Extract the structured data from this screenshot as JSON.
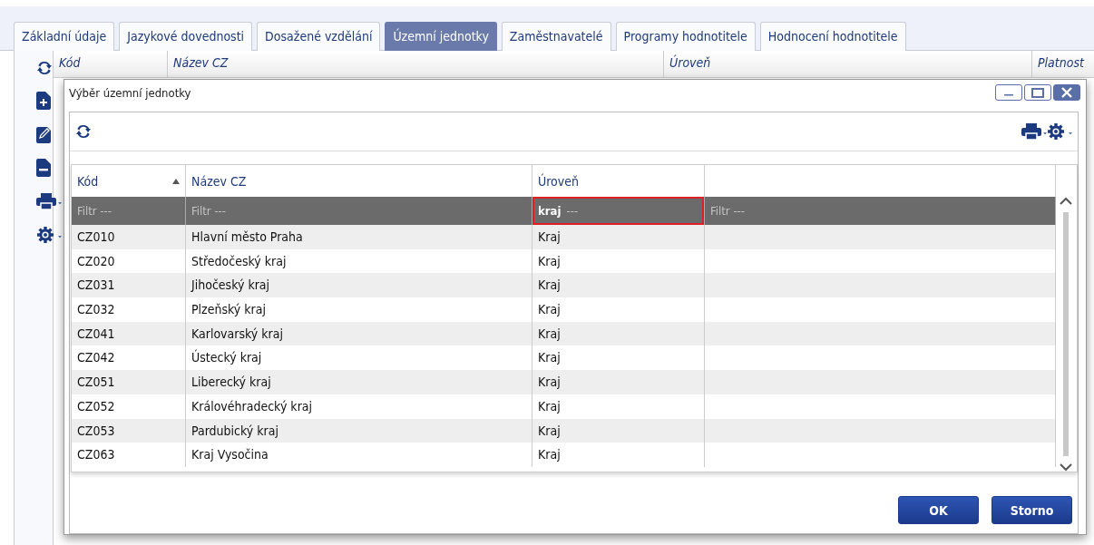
{
  "tabs": [
    {
      "label": "Základní údaje",
      "selected": false
    },
    {
      "label": "Jazykové dovednosti",
      "selected": false
    },
    {
      "label": "Dosažené vzdělání",
      "selected": false
    },
    {
      "label": "Územní jednotky",
      "selected": true
    },
    {
      "label": "Zaměstnavatelé",
      "selected": false
    },
    {
      "label": "Programy hodnotitele",
      "selected": false
    },
    {
      "label": "Hodnocení hodnotitele",
      "selected": false
    }
  ],
  "background_grid": {
    "columns": [
      "Kód",
      "Název CZ",
      "Úroveň",
      "Platnost"
    ]
  },
  "dialog": {
    "title": "Výběr územní jednotky",
    "grid": {
      "columns": [
        {
          "label": "Kód",
          "sorted": true
        },
        {
          "label": "Název CZ",
          "sorted": false
        },
        {
          "label": "Úroveň",
          "sorted": false
        }
      ],
      "filters": [
        {
          "placeholder": "Filtr ---",
          "highlighted": false
        },
        {
          "placeholder": "Filtr ---",
          "highlighted": false
        },
        {
          "placeholder": "---",
          "value": "kraj",
          "highlighted": true
        },
        {
          "placeholder": "Filtr ---",
          "highlighted": false
        }
      ],
      "rows": [
        {
          "code": "CZ010",
          "name": "Hlavní město Praha",
          "level": "Kraj"
        },
        {
          "code": "CZ020",
          "name": "Středočeský kraj",
          "level": "Kraj"
        },
        {
          "code": "CZ031",
          "name": "Jihočeský kraj",
          "level": "Kraj"
        },
        {
          "code": "CZ032",
          "name": "Plzeňský kraj",
          "level": "Kraj"
        },
        {
          "code": "CZ041",
          "name": "Karlovarský kraj",
          "level": "Kraj"
        },
        {
          "code": "CZ042",
          "name": "Ústecký kraj",
          "level": "Kraj"
        },
        {
          "code": "CZ051",
          "name": "Liberecký kraj",
          "level": "Kraj"
        },
        {
          "code": "CZ052",
          "name": "Královéhradecký kraj",
          "level": "Kraj"
        },
        {
          "code": "CZ053",
          "name": "Pardubický kraj",
          "level": "Kraj"
        },
        {
          "code": "CZ063",
          "name": "Kraj Vysočina",
          "level": "Kraj"
        }
      ]
    },
    "buttons": [
      "OK",
      "Storno"
    ]
  }
}
